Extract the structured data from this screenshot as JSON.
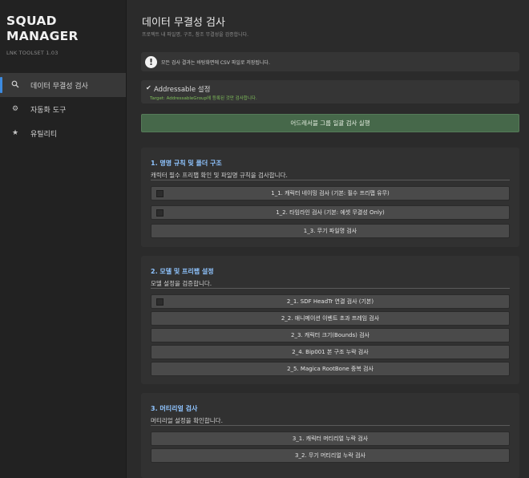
{
  "sidebar": {
    "title": "SQUAD\nMANAGER",
    "version": "LNK TOOLSET 1.03",
    "items": [
      {
        "icon": "search-icon",
        "label": "데이터 무결성 검사",
        "active": true
      },
      {
        "icon": "gear-icon",
        "label": "자동화 도구",
        "active": false
      },
      {
        "icon": "star-icon",
        "label": "유틸리티",
        "active": false
      }
    ]
  },
  "main": {
    "title": "데이터 무결성 검사",
    "subtitle": "프로젝트 내 파일명, 구조, 참조 무결성을 검증합니다.",
    "notice": "모든 검사 결과는 바탕화면에 CSV 파일로 저장됩니다.",
    "addressable": {
      "checked": true,
      "label": "Addressable 설정",
      "target": "Target: AddressableGroup에 등록된 것만 검사합니다."
    },
    "run_button": "어드레서블 그룹 일괄 검사 실행",
    "sections": [
      {
        "title": "1. 명명 규칙 및 폴더 구조",
        "desc": "캐릭터 필수 프리팹 확인 및 파일명 규칙을 검사합니다.",
        "buttons": [
          {
            "label": "1_1. 캐릭터 네이밍 검사 (기본: 필수 프리팹 유무)",
            "checkbox": true
          },
          {
            "label": "1_2. 타임라인 검사 (기본: 에셋 무결성 Only)",
            "checkbox": true
          },
          {
            "label": "1_3. 무기 파일명 검사",
            "checkbox": false
          }
        ]
      },
      {
        "title": "2. 모델 및 프리팹 설정",
        "desc": "모델 설정을 검증합니다.",
        "buttons": [
          {
            "label": "2_1. SDF HeadTr 연결 검사 (기본)",
            "checkbox": true
          },
          {
            "label": "2_2. 애니메이션 이벤트 초과 프레임 검사",
            "checkbox": false
          },
          {
            "label": "2_3. 캐릭터 크기(Bounds) 검사",
            "checkbox": false
          },
          {
            "label": "2_4. Bip001 본 구조 누락 검사",
            "checkbox": false
          },
          {
            "label": "2_5. Magica RootBone 중복 검사",
            "checkbox": false
          }
        ]
      },
      {
        "title": "3. 머티리얼 검사",
        "desc": "머티리얼 설정을 확인합니다.",
        "buttons": [
          {
            "label": "3_1. 캐릭터 머티리얼 누락 검사",
            "checkbox": false
          },
          {
            "label": "3_2. 무기 머티리얼 누락 검사",
            "checkbox": false
          }
        ]
      }
    ]
  },
  "colors": {
    "accent": "#3d8be0",
    "section_title": "#8fc4ff",
    "run_button": "#46684a",
    "target_text": "#7fbf5a"
  }
}
